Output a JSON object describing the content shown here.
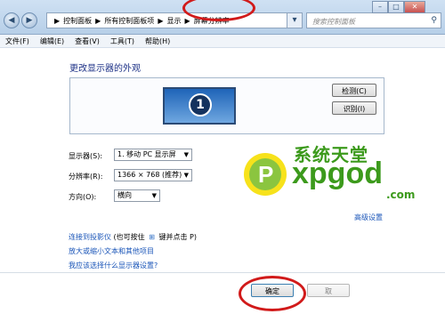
{
  "titlebar": {
    "back_icon": "back-arrow-icon",
    "forward_icon": "forward-arrow-icon",
    "breadcrumb": [
      "控制面板",
      "所有控制面板项",
      "显示",
      "屏幕分辨率"
    ],
    "search_placeholder": "搜索控制面板",
    "window_buttons": {
      "minimize": "–",
      "maximize": "□",
      "close": "✕"
    }
  },
  "menubar": [
    "文件(F)",
    "编辑(E)",
    "查看(V)",
    "工具(T)",
    "帮助(H)"
  ],
  "main": {
    "heading": "更改显示器的外观",
    "monitor_number": "1",
    "detect_button": "检测(C)",
    "identify_button": "识别(I)",
    "display_label": "显示器(S):",
    "display_value": "1. 移动 PC 显示屏",
    "resolution_label": "分辨率(R):",
    "resolution_value": "1366 × 768 (推荐)",
    "orientation_label": "方向(O):",
    "orientation_value": "横向",
    "advanced_link": "高级设置",
    "projector_link": "连接到投影仪",
    "projector_hint": "(也可按住",
    "projector_hint2": "键并点击 P)",
    "text_size_link": "放大或缩小文本和其他项目",
    "which_setting_link": "我应该选择什么显示器设置?",
    "ok_button": "确定",
    "cancel_button": "取"
  },
  "watermark": {
    "line1": "系统天堂",
    "line2": "xpgod",
    "line3": ".com"
  },
  "colors": {
    "accent_link": "#1a55b8",
    "annotation_red": "#d11a1a",
    "watermark_green": "#3c9a1c"
  }
}
